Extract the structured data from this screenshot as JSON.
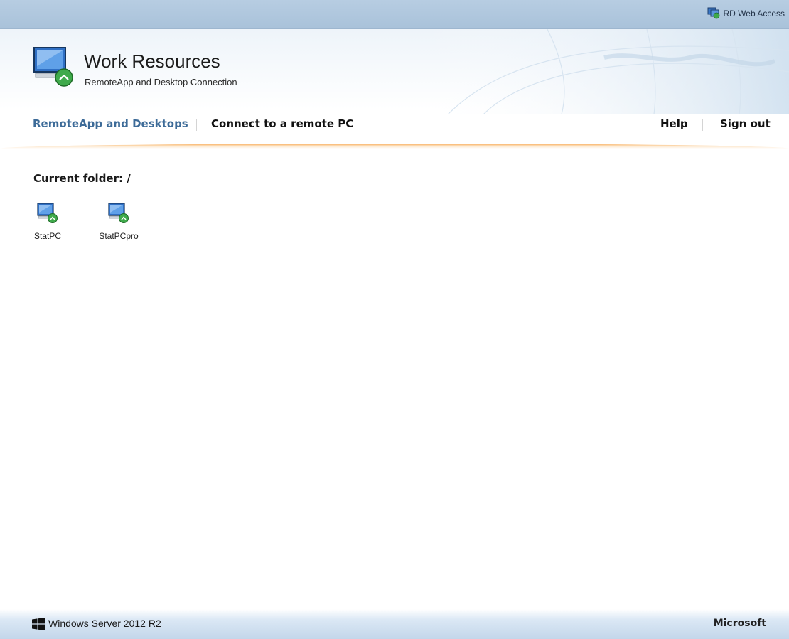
{
  "topbar": {
    "label": "RD Web Access",
    "icon": "rd-web-access-icon"
  },
  "header": {
    "title": "Work Resources",
    "subtitle": "RemoteApp and Desktop Connection",
    "logo_icon": "remote-desktop-logo-icon"
  },
  "nav": {
    "left": [
      {
        "label": "RemoteApp and Desktops",
        "active": true
      },
      {
        "label": "Connect to a remote PC",
        "active": false
      }
    ],
    "right": [
      {
        "label": "Help"
      },
      {
        "label": "Sign out"
      }
    ]
  },
  "main": {
    "folder_label": "Current folder: /",
    "resources": [
      {
        "label": "StatPC",
        "icon": "remote-desktop-icon"
      },
      {
        "label": "StatPCpro",
        "icon": "remote-desktop-icon"
      }
    ]
  },
  "footer": {
    "os_label": "Windows Server 2012 R2",
    "brand": "Microsoft",
    "icon": "windows-logo-icon"
  },
  "colors": {
    "accent_blue": "#3d6b98",
    "orange_rule": "#f79b38",
    "topbar": "#b7cde2"
  }
}
